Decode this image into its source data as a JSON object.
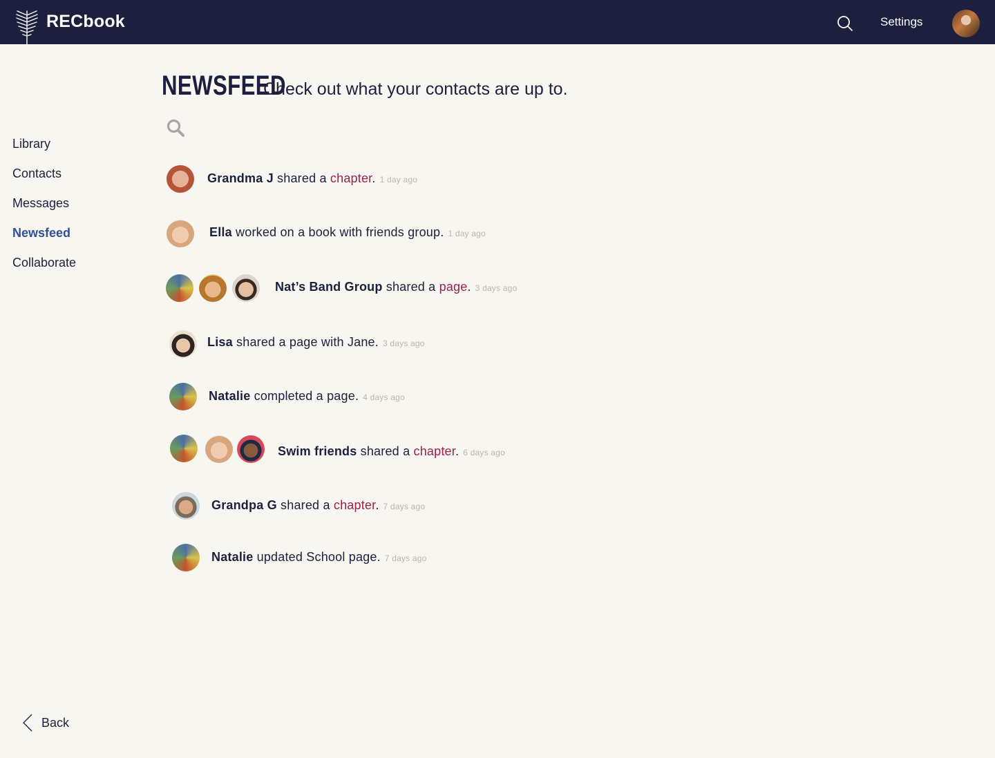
{
  "header": {
    "brand": "RECbook",
    "settings_label": "Settings",
    "icons": {
      "logo": "palm-leaf-logo-icon",
      "search": "search-icon",
      "avatar": "user-avatar"
    }
  },
  "sidebar": {
    "items": [
      {
        "label": "Library",
        "active": false
      },
      {
        "label": "Contacts",
        "active": false
      },
      {
        "label": "Messages",
        "active": false
      },
      {
        "label": "Newsfeed",
        "active": true
      },
      {
        "label": "Collaborate",
        "active": false
      }
    ]
  },
  "main": {
    "title": "NEWSFEED",
    "subtitle": "Check out what your contacts are up to."
  },
  "feed": [
    {
      "name": "Grandma J",
      "action": " shared a ",
      "link": "chapter",
      "tail": ".",
      "time": "1 day ago"
    },
    {
      "name": "Ella",
      "action": " worked on a book with friends group.",
      "link": "",
      "tail": "",
      "time": "1 day ago"
    },
    {
      "name": "Nat’s Band Group",
      "action": " shared a ",
      "link": "page",
      "tail": ".",
      "time": "3 days ago"
    },
    {
      "name": "Lisa",
      "action": " shared a page with Jane.",
      "link": "",
      "tail": "",
      "time": "3 days ago"
    },
    {
      "name": "Natalie",
      "action": " completed a page.",
      "link": "",
      "tail": "",
      "time": "4 days ago"
    },
    {
      "name": "Swim friends",
      "action": " shared a ",
      "link": "chapter",
      "tail": ".",
      "time": "6 days ago"
    },
    {
      "name": "Grandpa G",
      "action": " shared a ",
      "link": "chapter",
      "tail": ".",
      "time": "7 days ago"
    },
    {
      "name": "Natalie",
      "action": " updated School page.",
      "link": "",
      "tail": "",
      "time": "7 days ago"
    }
  ],
  "footer": {
    "back_label": "Back",
    "back_icon": "chevron-left-icon"
  },
  "colors": {
    "topbar": "#1c1f3d",
    "background": "#f8f6f1",
    "text": "#1c1f3d",
    "active_nav": "#2f4f96",
    "link": "#9a2048",
    "timestamp": "#b9b6ae"
  }
}
